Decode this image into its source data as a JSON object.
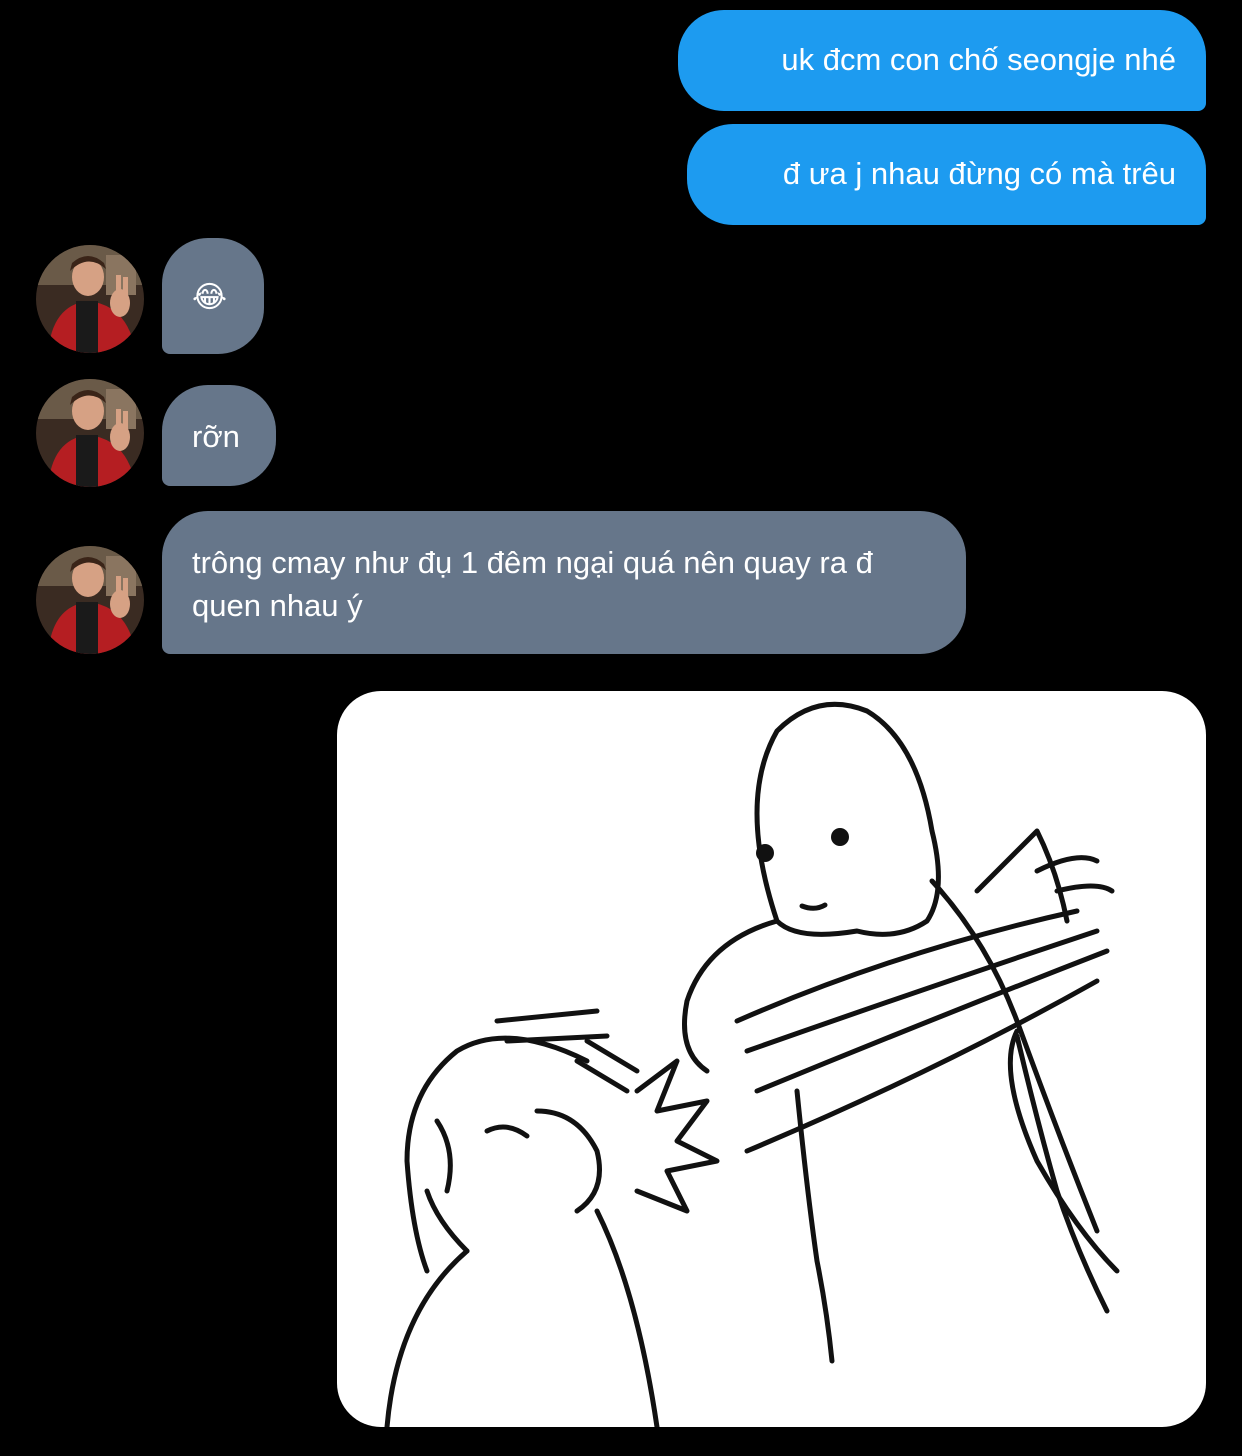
{
  "messages": [
    {
      "id": "m1",
      "direction": "outgoing",
      "text": "uk đcm con chố seongje nhé"
    },
    {
      "id": "m2",
      "direction": "outgoing",
      "text": "đ ưa j nhau đừng có mà trêu"
    },
    {
      "id": "m3",
      "direction": "incoming",
      "text": "😂"
    },
    {
      "id": "m4",
      "direction": "incoming",
      "text": "rỡn"
    },
    {
      "id": "m5",
      "direction": "incoming",
      "text": "trông cmay như đụ 1 đêm ngại quá nên quay ra đ quen nhau ý"
    }
  ],
  "media": {
    "type": "image",
    "subject": "meme-sketch-slap"
  },
  "colors": {
    "background": "#000000",
    "outgoing_bubble": "#1d9bf0",
    "incoming_bubble": "#66768a",
    "text": "#ffffff"
  }
}
